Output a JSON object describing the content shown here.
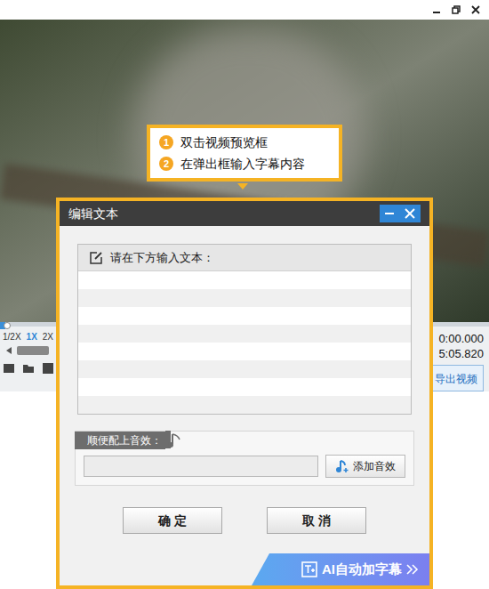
{
  "player": {
    "speeds": [
      {
        "label": "1/2X",
        "selected": false
      },
      {
        "label": "1X",
        "selected": true
      },
      {
        "label": "2X",
        "selected": false
      }
    ],
    "progress": 0.01,
    "current_time": "0:00.000",
    "total_time": "5:05.820",
    "export_button": "导出视频"
  },
  "callout": {
    "steps": [
      {
        "number": "1",
        "text": "双击视频预览框"
      },
      {
        "number": "2",
        "text": "在弹出框输入字幕内容"
      }
    ]
  },
  "dialog": {
    "title": "编辑文本",
    "text_label": "请在下方输入文本：",
    "sound_label": "顺便配上音效：",
    "add_sound_button": "添加音效",
    "ok_button": "确 定",
    "cancel_button": "取 消",
    "ai_button": "AI自动加字幕"
  }
}
